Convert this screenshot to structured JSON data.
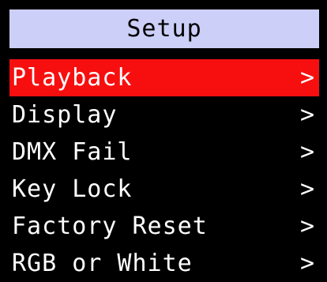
{
  "header": {
    "title": "Setup"
  },
  "menu": {
    "items": [
      {
        "label": "Playback",
        "arrow": ">"
      },
      {
        "label": "Display",
        "arrow": ">"
      },
      {
        "label": "DMX Fail",
        "arrow": ">"
      },
      {
        "label": "Key Lock",
        "arrow": ">"
      },
      {
        "label": "Factory Reset",
        "arrow": ">"
      },
      {
        "label": "RGB or White",
        "arrow": ">"
      }
    ],
    "selected_index": 0
  },
  "colors": {
    "background": "#000000",
    "title_bar": "#cccff7",
    "selected_highlight": "#f70f0f",
    "text": "#ffffff"
  },
  "icons": {
    "item_arrow": "chevron-right-icon"
  }
}
